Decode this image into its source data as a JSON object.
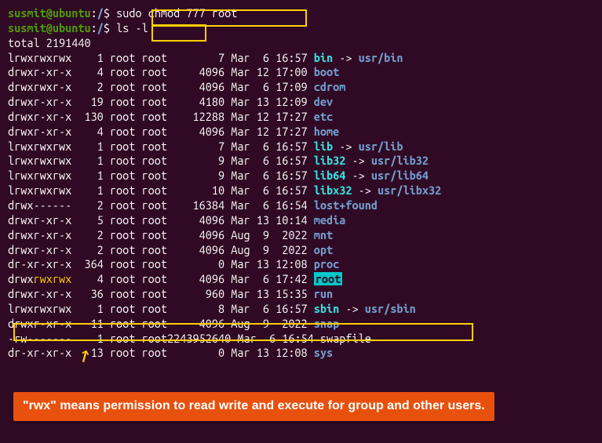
{
  "prompt": {
    "user": "susmit",
    "at": "@",
    "host": "ubuntu",
    "colon": ":",
    "path": "/",
    "dollar": "$ "
  },
  "cmd1": "sudo chmod 777 root",
  "cmd2": "ls -l",
  "total": "total 2191440",
  "rows": [
    {
      "perm": "lrwxrwxrwx",
      "n": "   1",
      "o": "root",
      "g": "root",
      "s": "        7",
      "d": "Mar  6 16:57",
      "name": "bin",
      "type": "link",
      "arrow": " -> ",
      "target": "usr/bin"
    },
    {
      "perm": "drwxr-xr-x",
      "n": "   4",
      "o": "root",
      "g": "root",
      "s": "     4096",
      "d": "Mar 12 17:00",
      "name": "boot",
      "type": "dir"
    },
    {
      "perm": "drwxrwxr-x",
      "n": "   2",
      "o": "root",
      "g": "root",
      "s": "     4096",
      "d": "Mar  6 17:09",
      "name": "cdrom",
      "type": "dir"
    },
    {
      "perm": "drwxr-xr-x",
      "n": "  19",
      "o": "root",
      "g": "root",
      "s": "     4180",
      "d": "Mar 13 12:09",
      "name": "dev",
      "type": "dir"
    },
    {
      "perm": "drwxr-xr-x",
      "n": " 130",
      "o": "root",
      "g": "root",
      "s": "    12288",
      "d": "Mar 12 17:27",
      "name": "etc",
      "type": "dir"
    },
    {
      "perm": "drwxr-xr-x",
      "n": "   4",
      "o": "root",
      "g": "root",
      "s": "     4096",
      "d": "Mar 12 17:27",
      "name": "home",
      "type": "dir"
    },
    {
      "perm": "lrwxrwxrwx",
      "n": "   1",
      "o": "root",
      "g": "root",
      "s": "        7",
      "d": "Mar  6 16:57",
      "name": "lib",
      "type": "link",
      "arrow": " -> ",
      "target": "usr/lib"
    },
    {
      "perm": "lrwxrwxrwx",
      "n": "   1",
      "o": "root",
      "g": "root",
      "s": "        9",
      "d": "Mar  6 16:57",
      "name": "lib32",
      "type": "link",
      "arrow": " -> ",
      "target": "usr/lib32"
    },
    {
      "perm": "lrwxrwxrwx",
      "n": "   1",
      "o": "root",
      "g": "root",
      "s": "        9",
      "d": "Mar  6 16:57",
      "name": "lib64",
      "type": "link",
      "arrow": " -> ",
      "target": "usr/lib64"
    },
    {
      "perm": "lrwxrwxrwx",
      "n": "   1",
      "o": "root",
      "g": "root",
      "s": "       10",
      "d": "Mar  6 16:57",
      "name": "libx32",
      "type": "link",
      "arrow": " -> ",
      "target": "usr/libx32"
    },
    {
      "perm": "drwx------",
      "n": "   2",
      "o": "root",
      "g": "root",
      "s": "    16384",
      "d": "Mar  6 16:54",
      "name": "lost+found",
      "type": "dir"
    },
    {
      "perm": "drwxr-xr-x",
      "n": "   5",
      "o": "root",
      "g": "root",
      "s": "     4096",
      "d": "Mar 13 10:14",
      "name": "media",
      "type": "dir"
    },
    {
      "perm": "drwxr-xr-x",
      "n": "   2",
      "o": "root",
      "g": "root",
      "s": "     4096",
      "d": "Aug  9  2022",
      "name": "mnt",
      "type": "dir"
    },
    {
      "perm": "drwxr-xr-x",
      "n": "   2",
      "o": "root",
      "g": "root",
      "s": "     4096",
      "d": "Aug  9  2022",
      "name": "opt",
      "type": "dir"
    },
    {
      "perm": "dr-xr-xr-x",
      "n": " 364",
      "o": "root",
      "g": "root",
      "s": "        0",
      "d": "Mar 13 12:08",
      "name": "proc",
      "type": "dir"
    },
    {
      "perm": "drwxrwxrwx",
      "permPrefix": "drwx",
      "permHighlight": "rwxrwx",
      "n": "   4",
      "o": "root",
      "g": "root",
      "s": "     4096",
      "d": "Mar  6 17:42",
      "name": "root",
      "type": "root-hl"
    },
    {
      "perm": "drwxr-xr-x",
      "n": "  36",
      "o": "root",
      "g": "root",
      "s": "      960",
      "d": "Mar 13 15:35",
      "name": "run",
      "type": "dir"
    },
    {
      "perm": "lrwxrwxrwx",
      "n": "   1",
      "o": "root",
      "g": "root",
      "s": "        8",
      "d": "Mar  6 16:57",
      "name": "sbin",
      "type": "link",
      "arrow": " -> ",
      "target": "usr/sbin"
    },
    {
      "perm": "drwxr-xr-x",
      "n": "  11",
      "o": "root",
      "g": "root",
      "s": "     4096",
      "d": "Aug  9  2022",
      "name": "snap",
      "type": "dir"
    }
  ],
  "swapRow": {
    "perm": "-rw-------",
    "n": "   1",
    "o": "root",
    "g": "root",
    "s": "2243952640",
    "d": "Mar  6 16:54",
    "name": "swapfile"
  },
  "sysRow": {
    "perm": "dr-xr-xr-x",
    "n": "  13",
    "o": "root",
    "g": "root",
    "s": "        0",
    "d": "Mar 13 12:08",
    "name": "sys"
  },
  "callout": "\"rwx\" means permission to read write and execute for group and other users."
}
